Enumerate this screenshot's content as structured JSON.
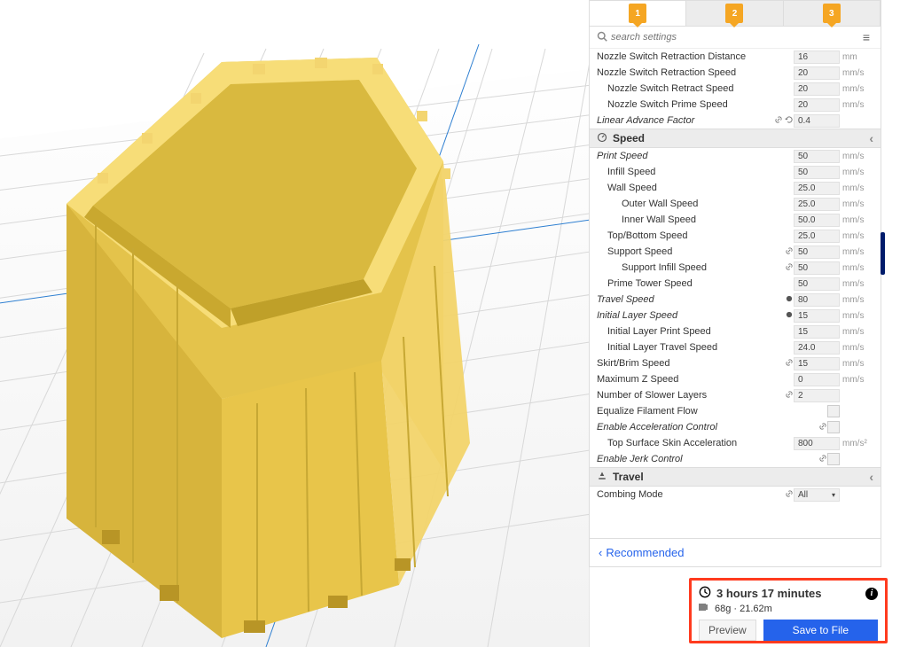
{
  "tabs": [
    "1",
    "2",
    "3"
  ],
  "search_placeholder": "search settings",
  "sections": {
    "speed_title": "Speed",
    "travel_title": "Travel"
  },
  "settings": [
    {
      "label": "Nozzle Switch Retraction Distance",
      "value": "16",
      "unit": "mm",
      "indent": 0
    },
    {
      "label": "Nozzle Switch Retraction Speed",
      "value": "20",
      "unit": "mm/s",
      "indent": 0
    },
    {
      "label": "Nozzle Switch Retract Speed",
      "value": "20",
      "unit": "mm/s",
      "indent": 1
    },
    {
      "label": "Nozzle Switch Prime Speed",
      "value": "20",
      "unit": "mm/s",
      "indent": 1
    },
    {
      "label": "Linear Advance Factor",
      "value": "0.4",
      "unit": "",
      "indent": 0,
      "italic": true,
      "icons": [
        "link",
        "reset"
      ]
    }
  ],
  "speed": [
    {
      "label": "Print Speed",
      "value": "50",
      "unit": "mm/s",
      "indent": 0,
      "italic": true
    },
    {
      "label": "Infill Speed",
      "value": "50",
      "unit": "mm/s",
      "indent": 1
    },
    {
      "label": "Wall Speed",
      "value": "25.0",
      "unit": "mm/s",
      "indent": 1
    },
    {
      "label": "Outer Wall Speed",
      "value": "25.0",
      "unit": "mm/s",
      "indent": 2
    },
    {
      "label": "Inner Wall Speed",
      "value": "50.0",
      "unit": "mm/s",
      "indent": 2
    },
    {
      "label": "Top/Bottom Speed",
      "value": "25.0",
      "unit": "mm/s",
      "indent": 1
    },
    {
      "label": "Support Speed",
      "value": "50",
      "unit": "mm/s",
      "indent": 1,
      "icons": [
        "link"
      ]
    },
    {
      "label": "Support Infill Speed",
      "value": "50",
      "unit": "mm/s",
      "indent": 2,
      "icons": [
        "link"
      ]
    },
    {
      "label": "Prime Tower Speed",
      "value": "50",
      "unit": "mm/s",
      "indent": 1
    },
    {
      "label": "Travel Speed",
      "value": "80",
      "unit": "mm/s",
      "indent": 0,
      "italic": true,
      "icons": [
        "circle"
      ]
    },
    {
      "label": "Initial Layer Speed",
      "value": "15",
      "unit": "mm/s",
      "indent": 0,
      "italic": true,
      "icons": [
        "circle"
      ]
    },
    {
      "label": "Initial Layer Print Speed",
      "value": "15",
      "unit": "mm/s",
      "indent": 1
    },
    {
      "label": "Initial Layer Travel Speed",
      "value": "24.0",
      "unit": "mm/s",
      "indent": 1
    },
    {
      "label": "Skirt/Brim Speed",
      "value": "15",
      "unit": "mm/s",
      "indent": 0,
      "icons": [
        "link"
      ]
    },
    {
      "label": "Maximum Z Speed",
      "value": "0",
      "unit": "mm/s",
      "indent": 0
    },
    {
      "label": "Number of Slower Layers",
      "value": "2",
      "unit": "",
      "indent": 0,
      "icons": [
        "link"
      ]
    },
    {
      "label": "Equalize Filament Flow",
      "type": "check",
      "indent": 0
    },
    {
      "label": "Enable Acceleration Control",
      "type": "check",
      "indent": 0,
      "italic": true,
      "icons": [
        "link"
      ]
    },
    {
      "label": "Top Surface Skin Acceleration",
      "value": "800",
      "unit": "mm/s²",
      "indent": 1
    },
    {
      "label": "Enable Jerk Control",
      "type": "check",
      "indent": 0,
      "italic": true,
      "icons": [
        "link"
      ]
    }
  ],
  "combing": {
    "label": "Combing Mode",
    "value": "All",
    "icons": [
      "link"
    ]
  },
  "footer_link": "Recommended",
  "estimate": {
    "time": "3 hours 17 minutes",
    "material": "68g · 21.62m",
    "preview": "Preview",
    "save": "Save to File"
  }
}
